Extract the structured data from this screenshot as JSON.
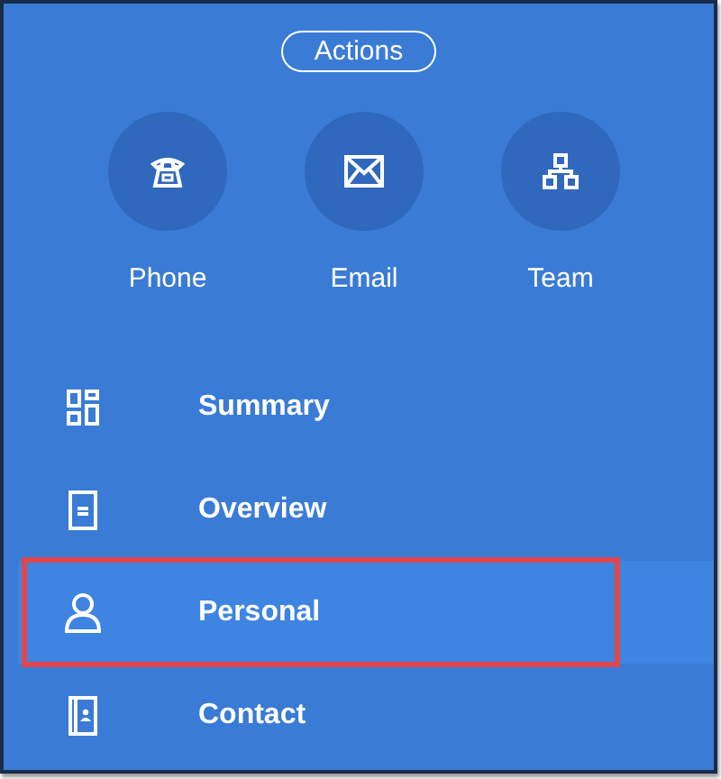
{
  "actions_button": "Actions",
  "actions": [
    {
      "kind": "phone",
      "label": "Phone"
    },
    {
      "kind": "email",
      "label": "Email"
    },
    {
      "kind": "team",
      "label": "Team"
    }
  ],
  "nav_items": [
    {
      "kind": "summary",
      "label": "Summary",
      "selected": false,
      "highlighted": false
    },
    {
      "kind": "overview",
      "label": "Overview",
      "selected": false,
      "highlighted": false
    },
    {
      "kind": "personal",
      "label": "Personal",
      "selected": true,
      "highlighted": true
    },
    {
      "kind": "contact",
      "label": "Contact",
      "selected": false,
      "highlighted": false
    }
  ]
}
